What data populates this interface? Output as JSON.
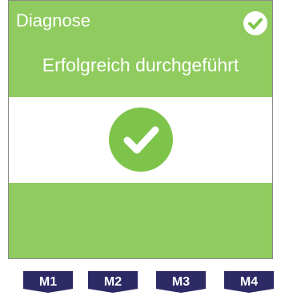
{
  "header": {
    "title": "Diagnose",
    "status_icon": "check-circle-icon"
  },
  "result": {
    "message": "Erfolgreich durchgeführt",
    "icon": "check-circle-icon"
  },
  "softkeys": [
    {
      "label": "M1"
    },
    {
      "label": "M2"
    },
    {
      "label": "M3"
    },
    {
      "label": "M4"
    }
  ],
  "colors": {
    "panel_green": "#8fcb5e",
    "check_green": "#7ec44b",
    "softkey_navy": "#2d2a66"
  }
}
